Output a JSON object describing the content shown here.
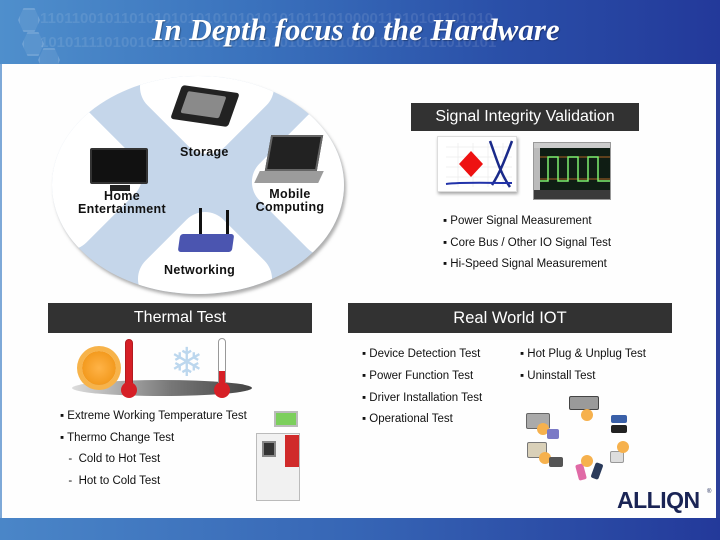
{
  "slide": {
    "title": "In Depth focus to the Hardware",
    "header_binary": [
      "1101100101101010101010101010101011101000011010101101010",
      "1010111101001010101010101010101010101010101010101010101"
    ],
    "colors": {
      "header_start": "#4f8fcc",
      "header_end": "#23399a",
      "section_header_bg": "#323232",
      "ellipse": "#c5d6ea",
      "logo": "#1a2455"
    }
  },
  "diagram": {
    "labels": {
      "storage": "Storage",
      "home_line1": "Home",
      "home_line2": "Entertainment",
      "mobile_line1": "Mobile",
      "mobile_line2": "Computing",
      "networking": "Networking"
    },
    "icons": [
      "hard-drive-icon",
      "tv-icon",
      "laptop-icon",
      "router-icon"
    ]
  },
  "signal_integrity": {
    "title": "Signal Integrity Validation",
    "bullets": [
      "▪ Power Signal Measurement",
      "▪ Core Bus / Other IO Signal Test",
      "▪ Hi-Speed Signal Measurement"
    ]
  },
  "thermal": {
    "title": "Thermal Test",
    "bullets": [
      "▪ Extreme Working Temperature Test",
      "▪ Thermo Change Test",
      "  -  Cold to Hot Test",
      "  -  Hot to Cold Test"
    ],
    "snowflake_glyph": "❄"
  },
  "iot": {
    "title": "Real World IOT",
    "bullets_left": [
      "▪ Device Detection Test",
      "▪ Power Function Test",
      "▪ Driver Installation Test",
      "▪ Operational Test"
    ],
    "bullets_right": [
      "▪ Hot Plug & Unplug Test",
      "▪ Uninstall Test"
    ]
  },
  "logo": {
    "text": "ALLIQN",
    "registered": "®"
  }
}
